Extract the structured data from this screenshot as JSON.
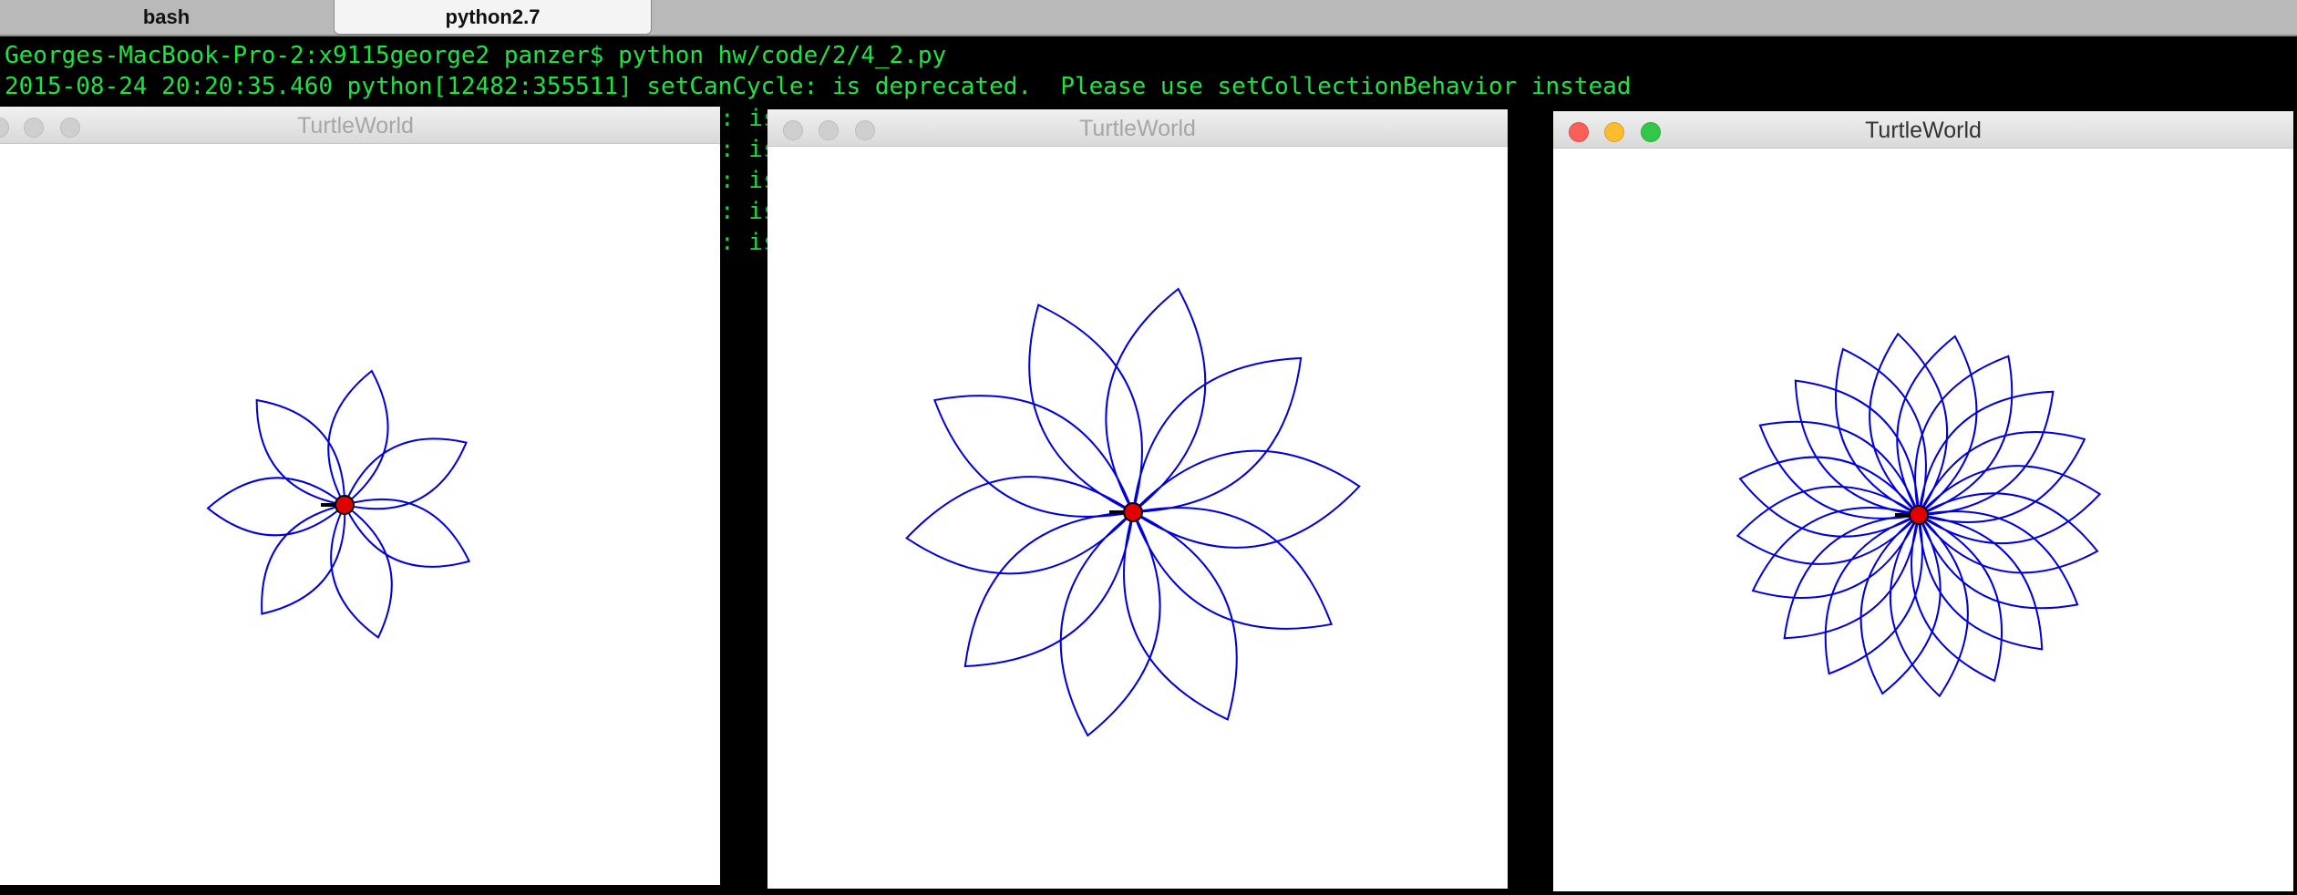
{
  "tabs": [
    {
      "label": "bash"
    },
    {
      "label": "python2.7"
    }
  ],
  "terminal": {
    "lines": [
      "Georges-MacBook-Pro-2:x9115george2 panzer$ python hw/code/2/4_2.py",
      "2015-08-24 20:20:35.460 python[12482:355511] setCanCycle: is deprecated.  Please use setCollectionBehavior instead"
    ],
    "partial_fragment": ": is"
  },
  "windows": [
    {
      "title": "TurtleWorld",
      "active": false,
      "petals": 7,
      "petal_span": 150,
      "turtle_heading": "east"
    },
    {
      "title": "TurtleWorld",
      "active": false,
      "petals": 10,
      "petal_span": 250,
      "turtle_heading": "east"
    },
    {
      "title": "TurtleWorld",
      "active": true,
      "petals": 20,
      "petal_span": 200,
      "turtle_heading": "east"
    }
  ],
  "colors": {
    "terminal_text": "#1ee344",
    "petal_stroke": "#0000dd",
    "turtle_fill": "#e00000",
    "close": "#fc5f57",
    "minimize": "#fdbc2e",
    "zoom": "#33c748"
  }
}
